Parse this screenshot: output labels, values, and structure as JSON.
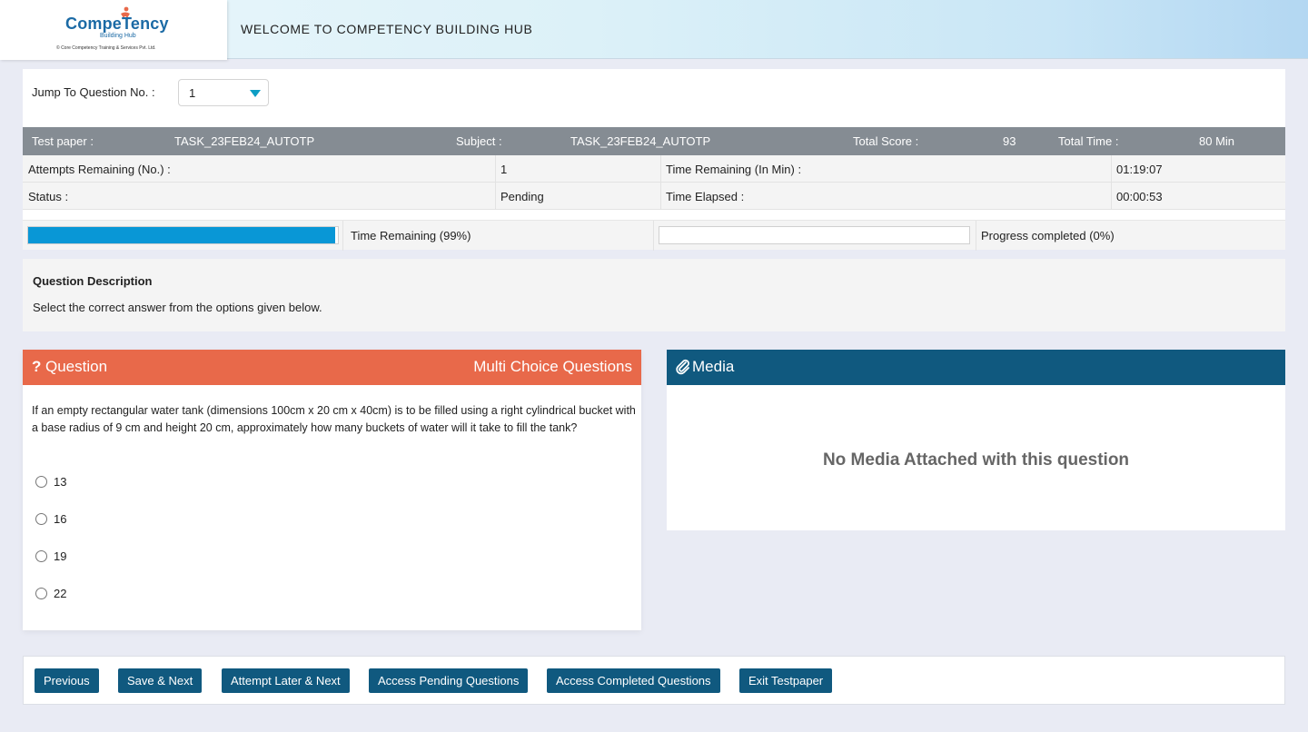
{
  "header": {
    "logo_name": "CompeTency",
    "logo_sub": "Building Hub",
    "logo_copyright": "© Core Competency Training & Services Pvt. Ltd.",
    "title": "WELCOME TO COMPETENCY BUILDING HUB"
  },
  "jump": {
    "label": "Jump To Question No. :",
    "selected": "1"
  },
  "info_bar": {
    "test_paper_label": "Test paper :",
    "test_paper_value": "TASK_23FEB24_AUTOTP",
    "subject_label": "Subject :",
    "subject_value": "TASK_23FEB24_AUTOTP",
    "total_score_label": "Total Score :",
    "total_score_value": "93",
    "total_time_label": "Total Time :",
    "total_time_value": "80 Min"
  },
  "stats": {
    "attempts_label": "Attempts Remaining (No.) :",
    "attempts_value": "1",
    "time_remaining_label": "Time Remaining (In Min) :",
    "time_remaining_value": "01:19:07",
    "status_label": "Status :",
    "status_value": "Pending",
    "time_elapsed_label": "Time Elapsed :",
    "time_elapsed_value": "00:00:53"
  },
  "progress": {
    "time_remaining_label": "Time Remaining (99%)",
    "time_remaining_fraction": 0.99,
    "completed_label": "Progress completed (0%)",
    "completed_fraction": 0.0,
    "time_bar_color": "#0997d6"
  },
  "description": {
    "title": "Question Description",
    "text": "Select the correct answer from the options given below."
  },
  "question": {
    "icon": "question-icon",
    "title": "Question",
    "type": "Multi Choice Questions",
    "header_color": "#e8694a",
    "text": "If an empty rectangular water tank (dimensions 100cm x 20 cm x 40cm) is to be filled using a right cylindrical bucket with a base radius of 9 cm and height 20 cm, approximately how many buckets of water will it take to fill the tank?",
    "options": [
      "13",
      "16",
      "19",
      "22"
    ]
  },
  "media": {
    "icon": "paperclip-icon",
    "title": "Media",
    "header_color": "#10597f",
    "empty_text": "No Media Attached with this question"
  },
  "footer": {
    "buttons": [
      "Previous",
      "Save & Next",
      "Attempt Later & Next",
      "Access Pending Questions",
      "Access Completed Questions",
      "Exit Testpaper"
    ],
    "button_color": "#10597f"
  }
}
